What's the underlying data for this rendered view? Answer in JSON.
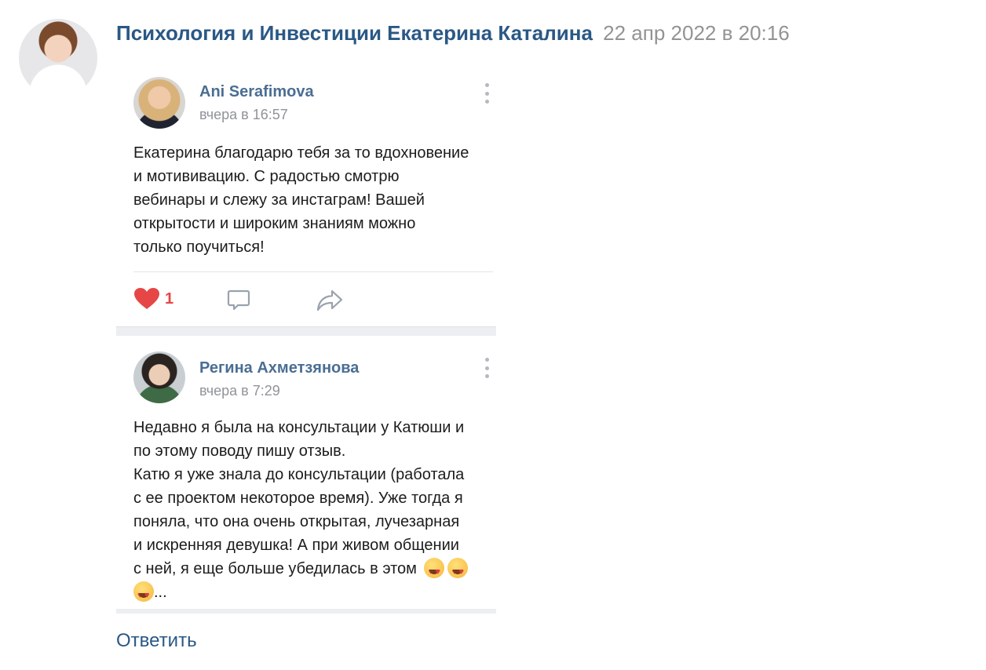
{
  "comment": {
    "author": "Психология и Инвестиции Екатерина Каталина",
    "date": "22 апр 2022 в 20:16",
    "reply_label": "Ответить"
  },
  "screenshot": {
    "cards": [
      {
        "name": "Ani Serafimova",
        "time": "вчера в 16:57",
        "lines": [
          "Екатерина благодарю тебя за то вдохновение",
          "и мотививацию. С радостью смотрю",
          "вебинары и слежу за инстаграм! Вашей",
          "открытости и широким знаниям можно",
          "только поучиться!"
        ],
        "likes": "1"
      },
      {
        "name": "Регина Ахметзянова",
        "time": "вчера в 7:29",
        "lines": [
          "Недавно я была на консультации у Катюши и",
          "по этому поводу пишу отзыв.",
          "Катю я уже знала до консультации (работала",
          "с ее проектом некоторое время). Уже тогда я",
          "поняла, что она очень открытая, лучезарная",
          "и искренняя девушка! А при живом общении",
          "с ней, я еще больше убедилась в этом"
        ],
        "ellipsis": "..."
      }
    ]
  },
  "icons": [
    "heart-icon",
    "comment-icon",
    "share-icon",
    "more-icon",
    "heart-eyes-emoji"
  ],
  "colors": {
    "link": "#2a5885",
    "muted": "#939393",
    "like": "#e64646"
  }
}
